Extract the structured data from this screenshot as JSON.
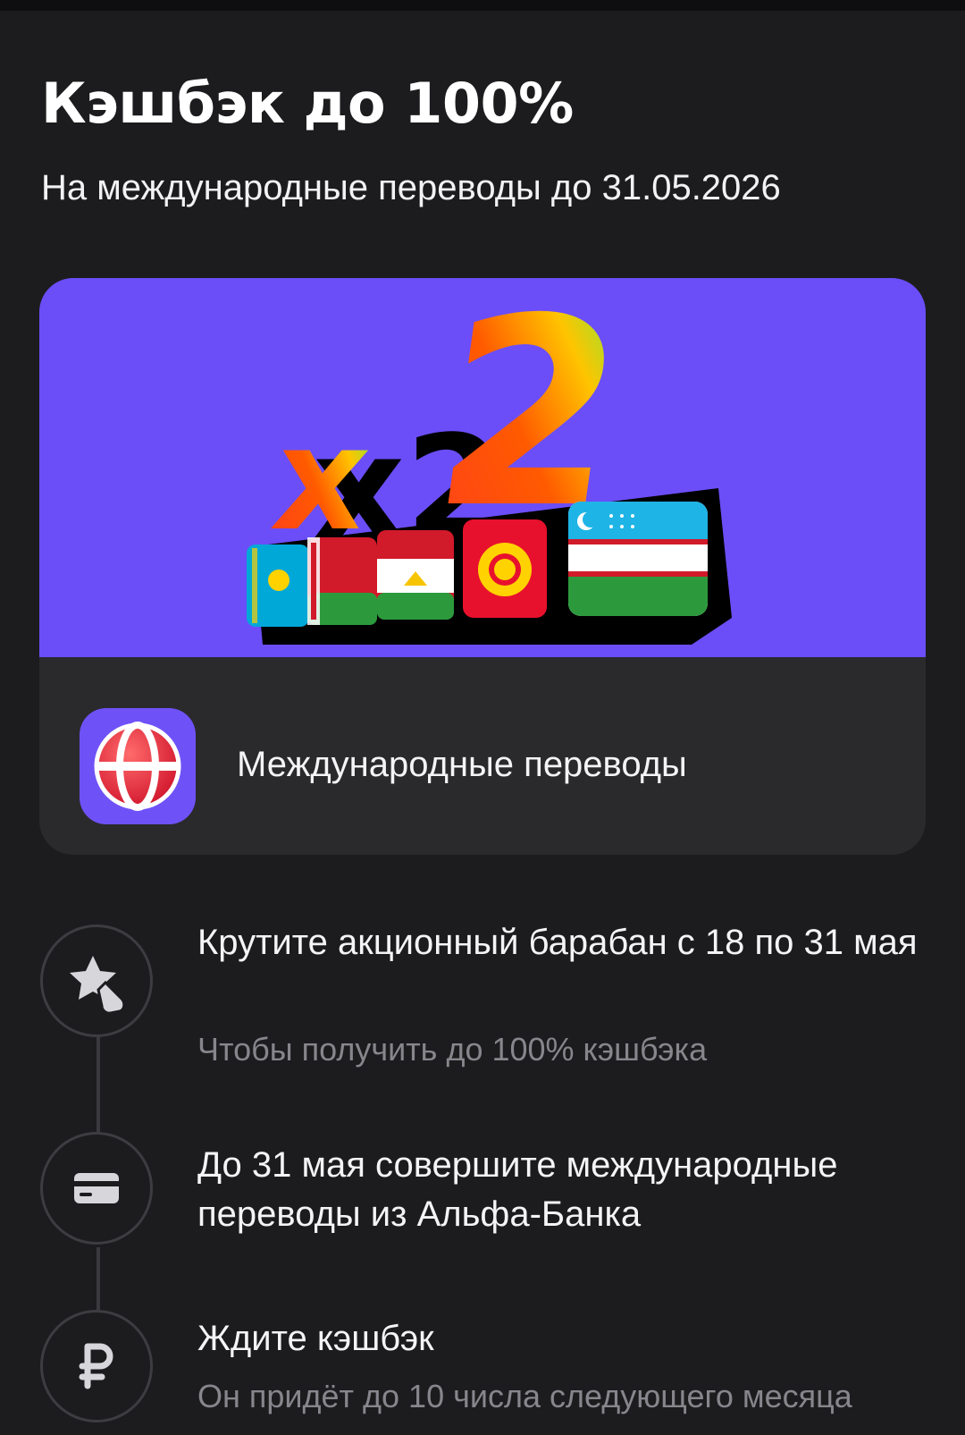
{
  "header": {
    "title": "Кэшбэк до 100%",
    "subtitle": "На международные переводы до 31.05.2026"
  },
  "promo": {
    "banner_text": "x2",
    "banner_flags": [
      "kazakhstan-flag",
      "belarus-flag",
      "tajikistan-flag",
      "kyrgyzstan-flag",
      "uzbekistan-flag"
    ],
    "service_label": "Международные переводы",
    "service_icon": "globe-icon"
  },
  "steps": [
    {
      "icon": "star-tap-icon",
      "title": "Крутите акционный барабан с 18 по 31 мая",
      "description": "Чтобы получить до 100% кэшбэка"
    },
    {
      "icon": "card-icon",
      "title": "До 31 мая совершите международные переводы из Альфа-Банка",
      "description": ""
    },
    {
      "icon": "ruble-icon",
      "title": "Ждите кэшбэк",
      "description": "Он придёт до 10 числа следующего месяца"
    }
  ],
  "colors": {
    "background": "#1c1c1e",
    "banner": "#6b4ef8",
    "card": "#2a2a2d",
    "secondary_text": "#86868c",
    "accent_red": "#ef3124"
  }
}
